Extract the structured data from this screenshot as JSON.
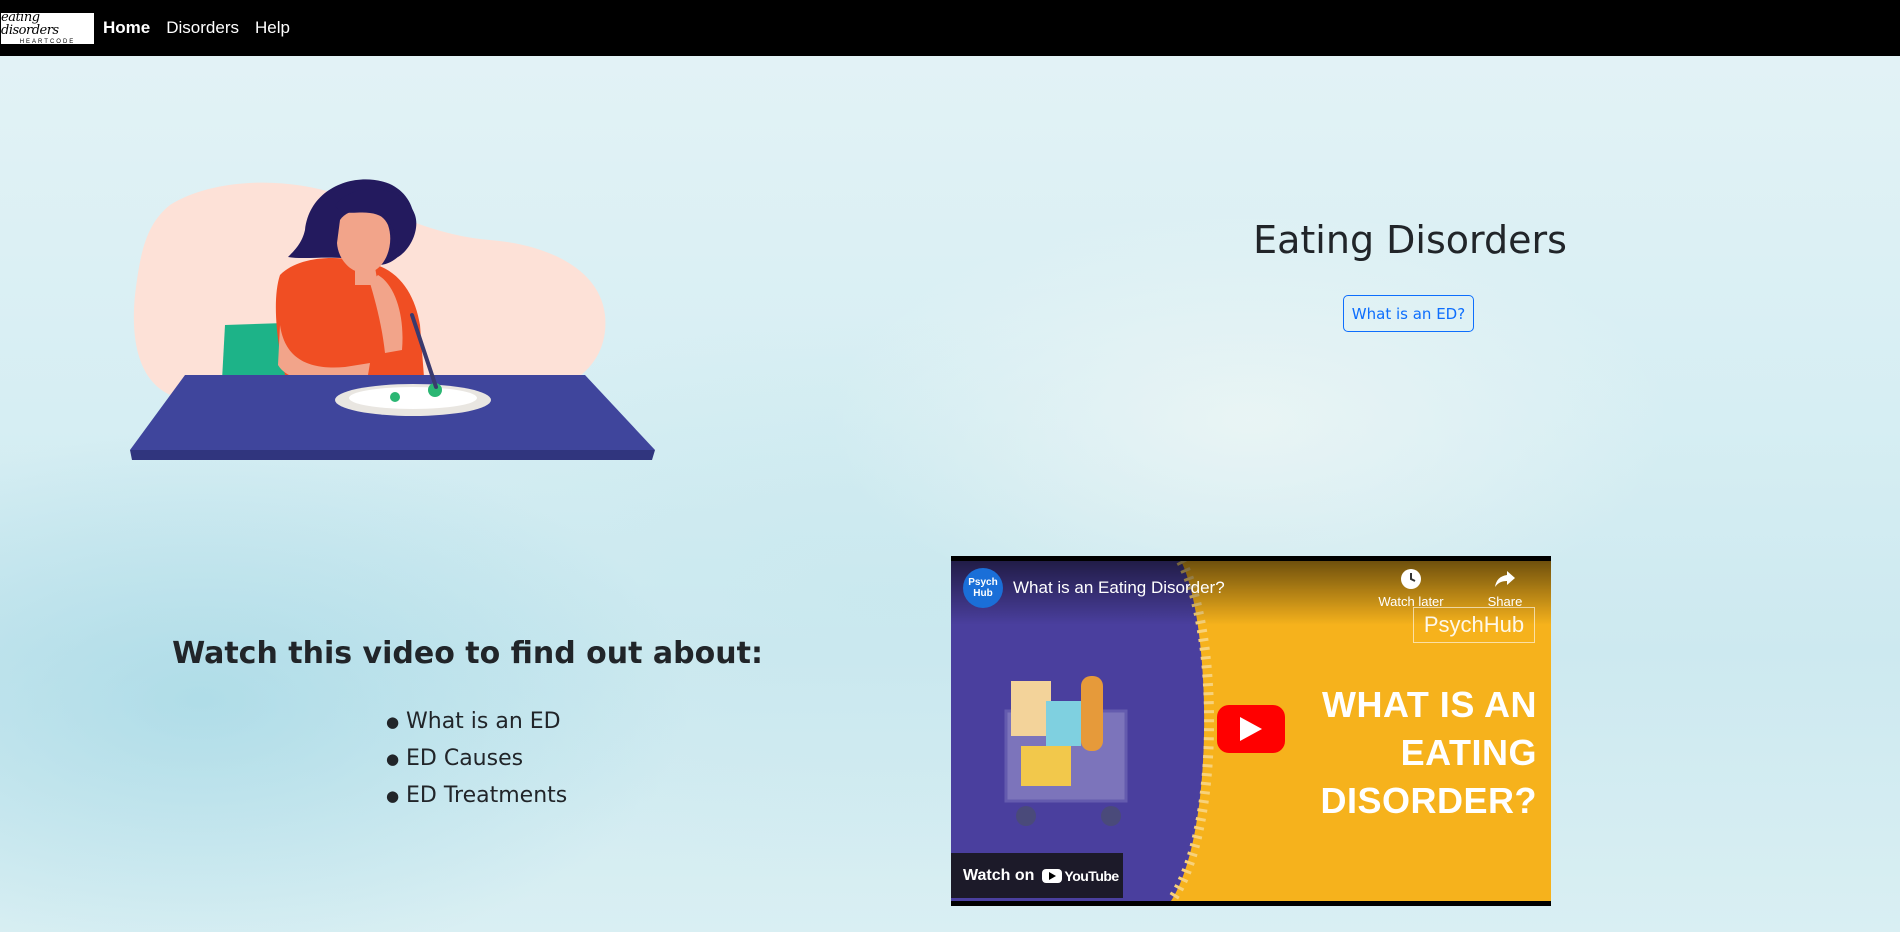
{
  "navbar": {
    "logo_text": "eating disorders",
    "logo_subtext": "HEARTCODE",
    "links": [
      {
        "label": "Home",
        "active": true
      },
      {
        "label": "Disorders",
        "active": false
      },
      {
        "label": "Help",
        "active": false
      }
    ]
  },
  "hero": {
    "title": "Eating Disorders",
    "button_label": "What is an ED?"
  },
  "video_section": {
    "heading": "Watch this video to find out about:",
    "topics": [
      "What is an ED",
      "ED Causes",
      "ED Treatments"
    ]
  },
  "video": {
    "channel_avatar_text": "Psych Hub",
    "title": "What is an Eating Disorder?",
    "watch_later_label": "Watch later",
    "share_label": "Share",
    "brand_watermark": "PsychHub",
    "thumbnail_title": "WHAT IS AN EATING DISORDER?",
    "watch_on_label": "Watch on",
    "youtube_label": "YouTube"
  },
  "colors": {
    "navbar_bg": "#000000",
    "button_accent": "#0d6efd",
    "thumbnail_yellow": "#f6b21c",
    "thumbnail_purple": "#4a3f9e",
    "youtube_red": "#ff0000"
  }
}
